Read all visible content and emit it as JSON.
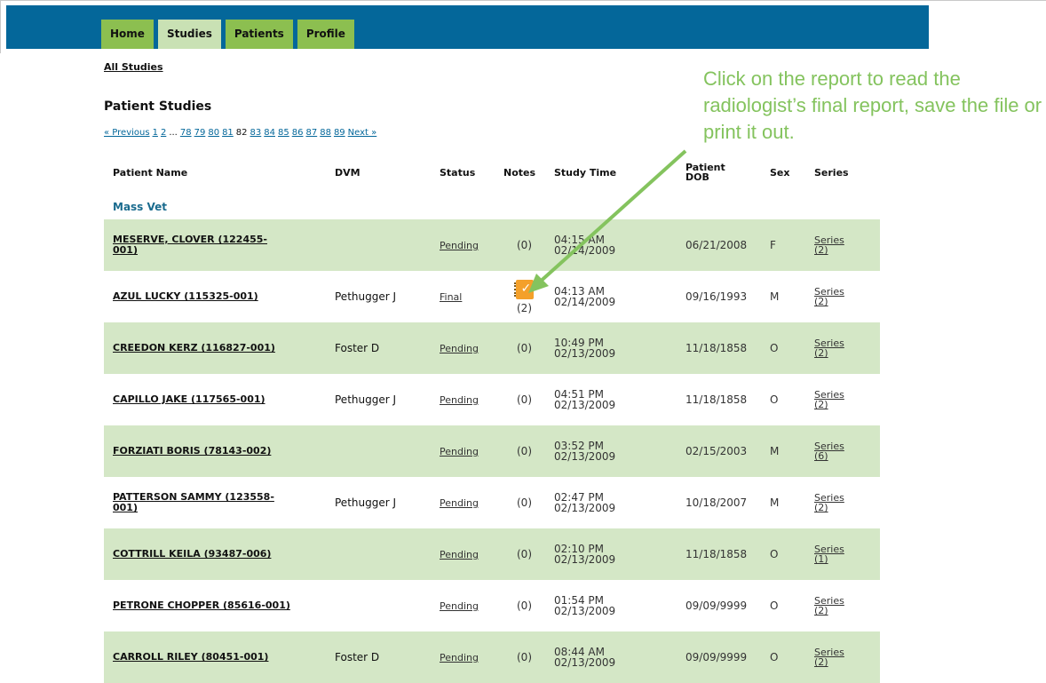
{
  "nav": {
    "tabs": [
      {
        "label": "Home",
        "active": false
      },
      {
        "label": "Studies",
        "active": true
      },
      {
        "label": "Patients",
        "active": false
      },
      {
        "label": "Profile",
        "active": false
      }
    ]
  },
  "breadcrumb": {
    "all_studies": "All Studies"
  },
  "page_title": "Patient Studies",
  "pager": {
    "previous": "« Previous",
    "pages_start": [
      "1",
      "2"
    ],
    "ellipsis": "...",
    "pages_mid": [
      "78",
      "79",
      "80",
      "81"
    ],
    "current": "82",
    "pages_end": [
      "83",
      "84",
      "85",
      "86",
      "87",
      "88",
      "89"
    ],
    "next": "Next »"
  },
  "callout": {
    "text": "Click on the report to read the radiologist’s final report, save the file or print it out."
  },
  "table": {
    "headers": {
      "patient_name": "Patient Name",
      "dvm": "DVM",
      "status": "Status",
      "notes": "Notes",
      "study_time": "Study Time",
      "patient_dob_1": "Patient",
      "patient_dob_2": "DOB",
      "sex": "Sex",
      "series": "Series"
    },
    "group": "Mass Vet",
    "rows": [
      {
        "name1": "MESERVE, CLOVER (122455-",
        "name2": "001)",
        "dvm": "",
        "status": "Pending",
        "notes": "(0)",
        "time": "04:15 AM",
        "date": "02/14/2009",
        "dob": "06/21/2008",
        "sex": "F",
        "series1": "Series",
        "series2": "(2)"
      },
      {
        "name1": "AZUL LUCKY (115325-001)",
        "name2": "",
        "dvm": "Pethugger J",
        "status": "Final",
        "notes": "(2)",
        "time": "04:13 AM",
        "date": "02/14/2009",
        "dob": "09/16/1993",
        "sex": "M",
        "series1": "Series",
        "series2": "(2)"
      },
      {
        "name1": "CREEDON KERZ (116827-001)",
        "name2": "",
        "dvm": "Foster D",
        "status": "Pending",
        "notes": "(0)",
        "time": "10:49 PM",
        "date": "02/13/2009",
        "dob": "11/18/1858",
        "sex": "O",
        "series1": "Series",
        "series2": "(2)"
      },
      {
        "name1": "CAPILLO JAKE (117565-001)",
        "name2": "",
        "dvm": "Pethugger J",
        "status": "Pending",
        "notes": "(0)",
        "time": "04:51 PM",
        "date": "02/13/2009",
        "dob": "11/18/1858",
        "sex": "O",
        "series1": "Series",
        "series2": "(2)"
      },
      {
        "name1": "FORZIATI BORIS (78143-002)",
        "name2": "",
        "dvm": "",
        "status": "Pending",
        "notes": "(0)",
        "time": "03:52 PM",
        "date": "02/13/2009",
        "dob": "02/15/2003",
        "sex": "M",
        "series1": "Series",
        "series2": "(6)"
      },
      {
        "name1": "PATTERSON SAMMY (123558-",
        "name2": "001)",
        "dvm": "Pethugger J",
        "status": "Pending",
        "notes": "(0)",
        "time": "02:47 PM",
        "date": "02/13/2009",
        "dob": "10/18/2007",
        "sex": "M",
        "series1": "Series",
        "series2": "(2)"
      },
      {
        "name1": "COTTRILL KEILA (93487-006)",
        "name2": "",
        "dvm": "",
        "status": "Pending",
        "notes": "(0)",
        "time": "02:10 PM",
        "date": "02/13/2009",
        "dob": "11/18/1858",
        "sex": "O",
        "series1": "Series",
        "series2": "(1)"
      },
      {
        "name1": "PETRONE CHOPPER (85616-001)",
        "name2": "",
        "dvm": "",
        "status": "Pending",
        "notes": "(0)",
        "time": "01:54 PM",
        "date": "02/13/2009",
        "dob": "09/09/9999",
        "sex": "O",
        "series1": "Series",
        "series2": "(2)"
      },
      {
        "name1": "CARROLL RILEY (80451-001)",
        "name2": "",
        "dvm": "Foster D",
        "status": "Pending",
        "notes": "(0)",
        "time": "08:44 AM",
        "date": "02/13/2009",
        "dob": "09/09/9999",
        "sex": "O",
        "series1": "Series",
        "series2": "(2)"
      }
    ]
  },
  "colors": {
    "nav_blue": "#04679a",
    "tab_green": "#8cbf50",
    "tab_active": "#c9e1b4",
    "row_shade": "#d4e7c6",
    "callout_green": "#84c35e",
    "note_icon": "#f4a02a"
  },
  "icons": {
    "note": "report-note-icon",
    "arrow": "callout-arrow-icon"
  }
}
